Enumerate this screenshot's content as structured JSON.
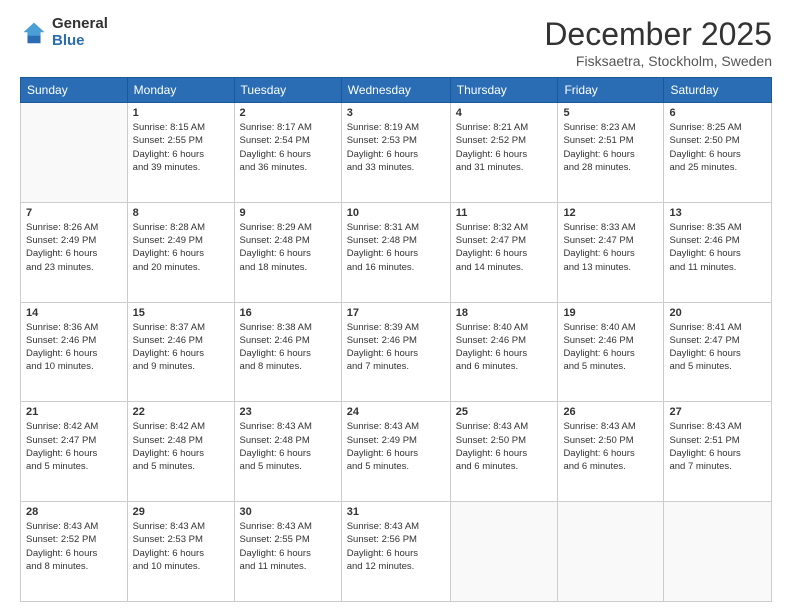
{
  "logo": {
    "general": "General",
    "blue": "Blue"
  },
  "header": {
    "month": "December 2025",
    "location": "Fisksaetra, Stockholm, Sweden"
  },
  "days_of_week": [
    "Sunday",
    "Monday",
    "Tuesday",
    "Wednesday",
    "Thursday",
    "Friday",
    "Saturday"
  ],
  "weeks": [
    [
      {
        "day": "",
        "info": ""
      },
      {
        "day": "1",
        "info": "Sunrise: 8:15 AM\nSunset: 2:55 PM\nDaylight: 6 hours\nand 39 minutes."
      },
      {
        "day": "2",
        "info": "Sunrise: 8:17 AM\nSunset: 2:54 PM\nDaylight: 6 hours\nand 36 minutes."
      },
      {
        "day": "3",
        "info": "Sunrise: 8:19 AM\nSunset: 2:53 PM\nDaylight: 6 hours\nand 33 minutes."
      },
      {
        "day": "4",
        "info": "Sunrise: 8:21 AM\nSunset: 2:52 PM\nDaylight: 6 hours\nand 31 minutes."
      },
      {
        "day": "5",
        "info": "Sunrise: 8:23 AM\nSunset: 2:51 PM\nDaylight: 6 hours\nand 28 minutes."
      },
      {
        "day": "6",
        "info": "Sunrise: 8:25 AM\nSunset: 2:50 PM\nDaylight: 6 hours\nand 25 minutes."
      }
    ],
    [
      {
        "day": "7",
        "info": "Sunrise: 8:26 AM\nSunset: 2:49 PM\nDaylight: 6 hours\nand 23 minutes."
      },
      {
        "day": "8",
        "info": "Sunrise: 8:28 AM\nSunset: 2:49 PM\nDaylight: 6 hours\nand 20 minutes."
      },
      {
        "day": "9",
        "info": "Sunrise: 8:29 AM\nSunset: 2:48 PM\nDaylight: 6 hours\nand 18 minutes."
      },
      {
        "day": "10",
        "info": "Sunrise: 8:31 AM\nSunset: 2:48 PM\nDaylight: 6 hours\nand 16 minutes."
      },
      {
        "day": "11",
        "info": "Sunrise: 8:32 AM\nSunset: 2:47 PM\nDaylight: 6 hours\nand 14 minutes."
      },
      {
        "day": "12",
        "info": "Sunrise: 8:33 AM\nSunset: 2:47 PM\nDaylight: 6 hours\nand 13 minutes."
      },
      {
        "day": "13",
        "info": "Sunrise: 8:35 AM\nSunset: 2:46 PM\nDaylight: 6 hours\nand 11 minutes."
      }
    ],
    [
      {
        "day": "14",
        "info": "Sunrise: 8:36 AM\nSunset: 2:46 PM\nDaylight: 6 hours\nand 10 minutes."
      },
      {
        "day": "15",
        "info": "Sunrise: 8:37 AM\nSunset: 2:46 PM\nDaylight: 6 hours\nand 9 minutes."
      },
      {
        "day": "16",
        "info": "Sunrise: 8:38 AM\nSunset: 2:46 PM\nDaylight: 6 hours\nand 8 minutes."
      },
      {
        "day": "17",
        "info": "Sunrise: 8:39 AM\nSunset: 2:46 PM\nDaylight: 6 hours\nand 7 minutes."
      },
      {
        "day": "18",
        "info": "Sunrise: 8:40 AM\nSunset: 2:46 PM\nDaylight: 6 hours\nand 6 minutes."
      },
      {
        "day": "19",
        "info": "Sunrise: 8:40 AM\nSunset: 2:46 PM\nDaylight: 6 hours\nand 5 minutes."
      },
      {
        "day": "20",
        "info": "Sunrise: 8:41 AM\nSunset: 2:47 PM\nDaylight: 6 hours\nand 5 minutes."
      }
    ],
    [
      {
        "day": "21",
        "info": "Sunrise: 8:42 AM\nSunset: 2:47 PM\nDaylight: 6 hours\nand 5 minutes."
      },
      {
        "day": "22",
        "info": "Sunrise: 8:42 AM\nSunset: 2:48 PM\nDaylight: 6 hours\nand 5 minutes."
      },
      {
        "day": "23",
        "info": "Sunrise: 8:43 AM\nSunset: 2:48 PM\nDaylight: 6 hours\nand 5 minutes."
      },
      {
        "day": "24",
        "info": "Sunrise: 8:43 AM\nSunset: 2:49 PM\nDaylight: 6 hours\nand 5 minutes."
      },
      {
        "day": "25",
        "info": "Sunrise: 8:43 AM\nSunset: 2:50 PM\nDaylight: 6 hours\nand 6 minutes."
      },
      {
        "day": "26",
        "info": "Sunrise: 8:43 AM\nSunset: 2:50 PM\nDaylight: 6 hours\nand 6 minutes."
      },
      {
        "day": "27",
        "info": "Sunrise: 8:43 AM\nSunset: 2:51 PM\nDaylight: 6 hours\nand 7 minutes."
      }
    ],
    [
      {
        "day": "28",
        "info": "Sunrise: 8:43 AM\nSunset: 2:52 PM\nDaylight: 6 hours\nand 8 minutes."
      },
      {
        "day": "29",
        "info": "Sunrise: 8:43 AM\nSunset: 2:53 PM\nDaylight: 6 hours\nand 10 minutes."
      },
      {
        "day": "30",
        "info": "Sunrise: 8:43 AM\nSunset: 2:55 PM\nDaylight: 6 hours\nand 11 minutes."
      },
      {
        "day": "31",
        "info": "Sunrise: 8:43 AM\nSunset: 2:56 PM\nDaylight: 6 hours\nand 12 minutes."
      },
      {
        "day": "",
        "info": ""
      },
      {
        "day": "",
        "info": ""
      },
      {
        "day": "",
        "info": ""
      }
    ]
  ]
}
